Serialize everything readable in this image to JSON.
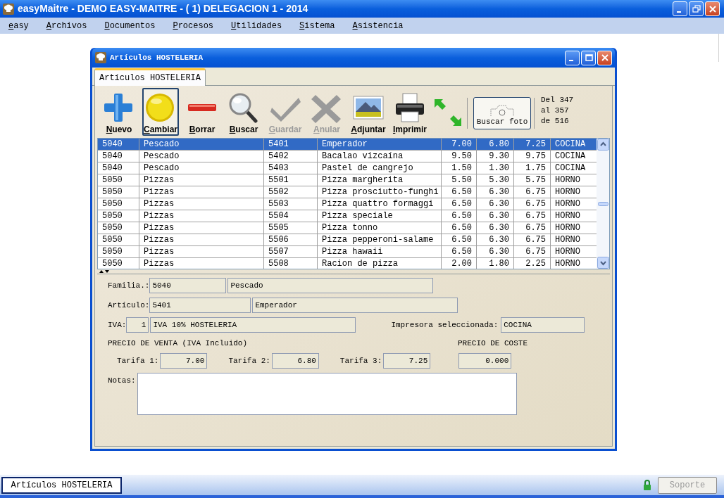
{
  "window": {
    "title": "easyMaitre - DEMO EASY-MAITRE - (  1) DELEGACION 1 - 2014"
  },
  "menu": [
    {
      "label": "easy"
    },
    {
      "label": "Archivos"
    },
    {
      "label": "Documentos"
    },
    {
      "label": "Procesos"
    },
    {
      "label": "Utilidades"
    },
    {
      "label": "Sistema"
    },
    {
      "label": "Asistencia"
    }
  ],
  "dialog": {
    "title": "Artículos HOSTELERIA",
    "tabs": [
      {
        "label": "Artículos HOSTELERIA",
        "selected": true
      }
    ],
    "toolbar": [
      {
        "label": "Nuevo",
        "kind": "plus",
        "disabled": false,
        "selected": false
      },
      {
        "label": "Cambiar",
        "kind": "circle",
        "disabled": false,
        "selected": true
      },
      {
        "label": "Borrar",
        "kind": "minus",
        "disabled": false,
        "selected": false
      },
      {
        "label": "Buscar",
        "kind": "search",
        "disabled": false,
        "selected": false
      },
      {
        "label": "Guardar",
        "kind": "check",
        "disabled": true,
        "selected": false
      },
      {
        "label": "Anular",
        "kind": "cross",
        "disabled": true,
        "selected": false
      },
      {
        "label": "Adjuntar",
        "kind": "image",
        "disabled": false,
        "selected": false
      },
      {
        "label": "Imprimir",
        "kind": "printer",
        "disabled": false,
        "selected": false
      }
    ],
    "photo_button": "Buscar foto",
    "record_range": [
      "Del 347",
      "al 357",
      "de 516"
    ],
    "table": {
      "rows": [
        {
          "selected": true,
          "cells": [
            "5040",
            "Pescado",
            "5401",
            "Emperador",
            "7.00",
            "6.80",
            "7.25",
            "COCINA"
          ]
        },
        {
          "selected": false,
          "cells": [
            "5040",
            "Pescado",
            "5402",
            "Bacalao vizcaína",
            "9.50",
            "9.30",
            "9.75",
            "COCINA"
          ]
        },
        {
          "selected": false,
          "cells": [
            "5040",
            "Pescado",
            "5403",
            "Pastel de cangrejo",
            "1.50",
            "1.30",
            "1.75",
            "COCINA"
          ]
        },
        {
          "selected": false,
          "cells": [
            "5050",
            "Pizzas",
            "5501",
            "Pizza margherita",
            "5.50",
            "5.30",
            "5.75",
            "HORNO"
          ]
        },
        {
          "selected": false,
          "cells": [
            "5050",
            "Pizzas",
            "5502",
            "Pizza prosciutto-funghi",
            "6.50",
            "6.30",
            "6.75",
            "HORNO"
          ]
        },
        {
          "selected": false,
          "cells": [
            "5050",
            "Pizzas",
            "5503",
            "Pizza quattro formaggi",
            "6.50",
            "6.30",
            "6.75",
            "HORNO"
          ]
        },
        {
          "selected": false,
          "cells": [
            "5050",
            "Pizzas",
            "5504",
            "Pizza speciale",
            "6.50",
            "6.30",
            "6.75",
            "HORNO"
          ]
        },
        {
          "selected": false,
          "cells": [
            "5050",
            "Pizzas",
            "5505",
            "Pizza tonno",
            "6.50",
            "6.30",
            "6.75",
            "HORNO"
          ]
        },
        {
          "selected": false,
          "cells": [
            "5050",
            "Pizzas",
            "5506",
            "Pizza pepperoni-salame",
            "6.50",
            "6.30",
            "6.75",
            "HORNO"
          ]
        },
        {
          "selected": false,
          "cells": [
            "5050",
            "Pizzas",
            "5507",
            "Pizza hawaii",
            "6.50",
            "6.30",
            "6.75",
            "HORNO"
          ]
        },
        {
          "selected": false,
          "cells": [
            "5050",
            "Pizzas",
            "5508",
            "Racion de pizza",
            "2.00",
            "1.80",
            "2.25",
            "HORNO"
          ]
        }
      ]
    },
    "form": {
      "familia": {
        "label": "Familia.:",
        "code": "5040",
        "name": "Pescado"
      },
      "articulo": {
        "label": "Artículo:",
        "code": "5401",
        "name": "Emperador"
      },
      "iva": {
        "label": "IVA:",
        "code": "1",
        "name": "IVA 10% HOSTELERIA"
      },
      "impresora": {
        "label": "Impresora seleccionada:",
        "value": "COCINA"
      },
      "sale_heading": "PRECIO DE VENTA (IVA Incluido)",
      "cost_heading": "PRECIO DE COSTE",
      "tarifas": [
        {
          "label": "Tarifa 1:",
          "value": "7.00"
        },
        {
          "label": "Tarifa 2:",
          "value": "6.80"
        },
        {
          "label": "Tarifa 3:",
          "value": "7.25"
        }
      ],
      "cost": "0.000",
      "notes_label": "Notas:"
    }
  },
  "taskbar": {
    "task": "Artículos HOSTELERIA",
    "support_button": {
      "label": "Soporte",
      "disabled": true
    }
  }
}
